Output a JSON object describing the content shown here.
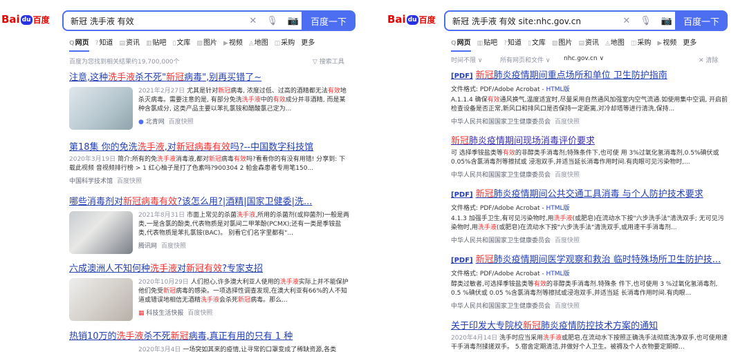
{
  "left": {
    "logo": {
      "bai": "Bai",
      "du": "du",
      "baidu": "百度"
    },
    "search": {
      "query": "新冠 洗手液 有效",
      "button": "百度一下"
    },
    "tabs": [
      "网页",
      "知道",
      "资讯",
      "贴吧",
      "文库",
      "图片",
      "视频",
      "地图",
      "采购",
      "更多"
    ],
    "result_count": "百度为您找到相关结果约19,700,000个",
    "tools": "搜索工具",
    "results": [
      {
        "title": [
          "注意,这种",
          "洗手液",
          "杀不死\"",
          "新冠",
          "病毒\",别再买错了~"
        ],
        "date": "2021年2月27日",
        "abstract": [
          "尤其是针对",
          "新冠",
          "病毒, 浓度过低、过高的酒精都无法",
          "有效",
          "地杀灭病毒。需要注意的是, 有部分免洗",
          "洗手液",
          "中的",
          "有效",
          "成分并非酒精, 而是某种含氯成分, 这类产品主要以苯扎氯铵和醋酸氯己定为..."
        ],
        "source": "北青网",
        "snapshot": "百度快照"
      },
      {
        "title": [
          "第18集 你的免洗",
          "洗手液",
          ",对",
          "新冠",
          "病毒",
          "有效",
          "吗?--中国数字科技馆"
        ],
        "date": "2020年3月19日",
        "abstract": [
          "简介:所有的免",
          "洗手液",
          "消毒液,都对",
          "新冠",
          "病毒",
          "有效",
          "吗?看看你的有没有用错! 分享到: 下载此视频 音视频排行榜 > 1 红心柚子是打了色素吗?900304 2 帕金森患者专用笔150..."
        ],
        "source": "中国科学技术馆",
        "snapshot": "百度快照"
      },
      {
        "title": [
          "哪些消毒剂对",
          "新冠",
          "病毒",
          "有效",
          "?该怎么用?|酒精|国家卫健委|洗..."
        ],
        "date": "2021年8月31日",
        "abstract": [
          "市面上常见的杀菌",
          "洗手液",
          ",所用的杀菌剂(或抑菌剂)一般是两类,一是含氯的酚类,代表物质是对氯间二甲苯酚(PCMX);还有一类是季铵盐类,代表物质是苯扎氯铵(BAC)。 别看它们名字里都有\"..."
        ],
        "source": "腾讯网",
        "snapshot": "百度快照"
      },
      {
        "title": [
          "六成澳洲人不知何种",
          "洗手液",
          "对",
          "新冠",
          "有效",
          "?专家支招"
        ],
        "date": "2020年10月29日",
        "abstract": [
          "人们担心,许多澳大利亚人使用的",
          "洗手液",
          "实际上并不能保护他们免受",
          "新冠",
          "病毒的感染。一项选择性调查发现,在澳大利亚有66%的人不知道或错误地相信无酒精",
          "洗手液",
          "会杀死",
          "新冠",
          "病毒。那么..."
        ],
        "source": "科技生活快报",
        "snapshot": "百度快照"
      },
      {
        "title": [
          "热销10万的",
          "洗手液",
          "杀不死",
          "新冠",
          "病毒,真正有用的只有 1 种"
        ],
        "date": "2020年3月4日",
        "abstract": [
          "一场突如其来的疫情,让寻常的口罩变成了稀缺资源,各类"
        ]
      }
    ]
  },
  "right": {
    "logo": {
      "bai": "Bai",
      "du": "du",
      "baidu": "百度"
    },
    "search": {
      "query": "新冠 洗手液 有效 site:nhc.gov.cn",
      "button": "百度一下"
    },
    "tabs": [
      "网页",
      "贴吧",
      "知道",
      "文库",
      "图片",
      "资讯",
      "地图",
      "采购",
      "视频",
      "更多"
    ],
    "filters": [
      "时间不限",
      "所有网页和文件",
      "nhc.gov.cn"
    ],
    "clear": "清除",
    "results": [
      {
        "pdf": "[PDF]",
        "title": [
          "新冠",
          "肺炎疫情期间重点场所和单位 卫生防护指南"
        ],
        "format": "文件格式: PDF/Adobe Acrobat - ",
        "html": "HTML版",
        "abstract": [
          "A.1.1.4 确保",
          "有效",
          "通风换气,温度适宜时,尽量采用自然通风加强室内空气流通.如使用集中空调, 开启前检查设备是否正常,新风口和排风口是否保持一定距离,对冷却塔等进行清洗,保持..."
        ],
        "source": "中华人民共和国国家卫生健康委员会",
        "snapshot": "百度快照"
      },
      {
        "pdf": "",
        "title": [
          "新冠",
          "肺炎疫情期间现场消毒评价要求"
        ],
        "abstract": [
          "可 选择季铵盐类等",
          "有效",
          "的非醇类手消毒剂;特殊条件下,也可使 用 3%过氧化氢消毒剂,0.5%碘伏或 0.05%含氯消毒剂等擦拭或 浸泡双手,并适当延长消毒作用时间.有肉眼可见污染物时,..."
        ],
        "source": "中华人民共和国国家卫生健康委员会",
        "snapshot": "百度快照"
      },
      {
        "pdf": "[PDF]",
        "title": [
          "新冠",
          "肺炎疫情期间公共交通工具消毒 与个人防护技术要求"
        ],
        "format": "文件格式: PDF/Adobe Acrobat - ",
        "html": "HTML版",
        "abstract": [
          "4.1.3 加强手卫生,有可见污染物时,用",
          "洗手液",
          "(或肥皂)在流动水下按\"六步洗手法\"清洗双手; 无可见污染物时,用",
          "洗手液",
          "(或肥皂)在流动水下按\"六步洗手法\"清洗双手,或用速干手消毒剂..."
        ],
        "source": "中华人民共和国国家卫生健康委员会",
        "snapshot": "百度快照"
      },
      {
        "pdf": "[PDF]",
        "title": [
          "新冠",
          "肺炎疫情期间医学观察和救治 临时特殊场所卫生防护技..."
        ],
        "format": "文件格式: PDF/Adobe Acrobat - ",
        "html": "HTML版",
        "abstract": [
          "醇类过敏者,可选择季铵盐类等",
          "有效",
          "的非醇类手消毒剂.特殊条 件下,也可使用 3 %过氧化氢消毒剂, 0.5 %碘伏或 0.05 %含氯消毒剂等擦拭或浸泡双手,并适当延 长消毒作用时间.有肉眼..."
        ],
        "source": "中华人民共和国国家卫生健康委员会",
        "snapshot": "百度快照"
      },
      {
        "pdf": "",
        "title": [
          "关于印发大专院校",
          "新冠",
          "肺炎疫情防控技术方案的通知"
        ],
        "date": "2020年4月14日",
        "abstract": [
          "洗手时应当采用",
          "洗手液",
          "或肥皂,在流动水下按照正确洗手法彻底洗净双手,也可使用速干手消毒剂揉搓双手。 5.宿舍定期清洁,并做好个人卫生。被褥及个人衣物要定期晾..."
        ]
      }
    ]
  }
}
